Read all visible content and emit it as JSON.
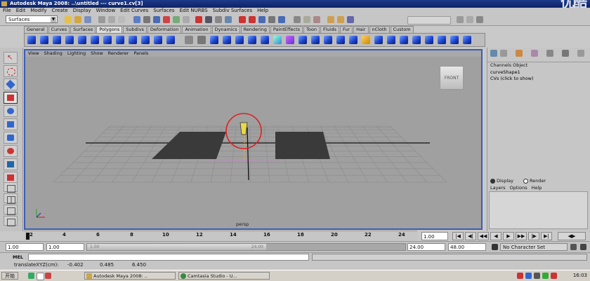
{
  "window": {
    "title": "Autodesk Maya 2008: ..\\untitled   ---   curve1.cv[3]",
    "watermark": "优酷"
  },
  "menu": [
    "File",
    "Edit",
    "Modify",
    "Create",
    "Display",
    "Window",
    "Edit Curves",
    "Surfaces",
    "Edit NURBS",
    "Subdiv Surfaces",
    "Help"
  ],
  "status": {
    "mode": "Surfaces"
  },
  "shelf_tabs": [
    "General",
    "Curves",
    "Surfaces",
    "Polygons",
    "Subdivs",
    "Deformation",
    "Animation",
    "Dynamics",
    "Rendering",
    "PaintEffects",
    "Toon",
    "Fluids",
    "Fur",
    "Hair",
    "nCloth",
    "Custom"
  ],
  "shelf_active": "Polygons",
  "viewport": {
    "menu": [
      "View",
      "Shading",
      "Lighting",
      "Show",
      "Renderer",
      "Panels"
    ],
    "camera": "persp",
    "view_cube": "FRONT"
  },
  "channel_box": {
    "tabs": "Channels  Object",
    "object": "curveShape1",
    "cvs": "CVs (click to show)",
    "display": "Display",
    "render": "Render",
    "layer_menu": [
      "Layers",
      "Options",
      "Help"
    ]
  },
  "time_slider": {
    "ticks": [
      "2",
      "4",
      "6",
      "8",
      "10",
      "12",
      "14",
      "16",
      "18",
      "20",
      "22",
      "24"
    ],
    "current_frame": "1.00"
  },
  "range_slider": {
    "start": "1.00",
    "start2": "1.00",
    "handle_start": "1.00",
    "handle_end": "24.00",
    "end": "24.00",
    "end2": "48.00",
    "character_set": "No Character Set"
  },
  "command_line": {
    "label": "MEL"
  },
  "help_line": {
    "text": "translateXYZ(cm):",
    "x": "-0.402",
    "y": "0.485",
    "z": "6.450"
  },
  "taskbar": {
    "start": "开始",
    "tasks": [
      "Autodesk Maya 2008: ..",
      "Camtasia Studio - U..."
    ],
    "clock": "16:03"
  }
}
